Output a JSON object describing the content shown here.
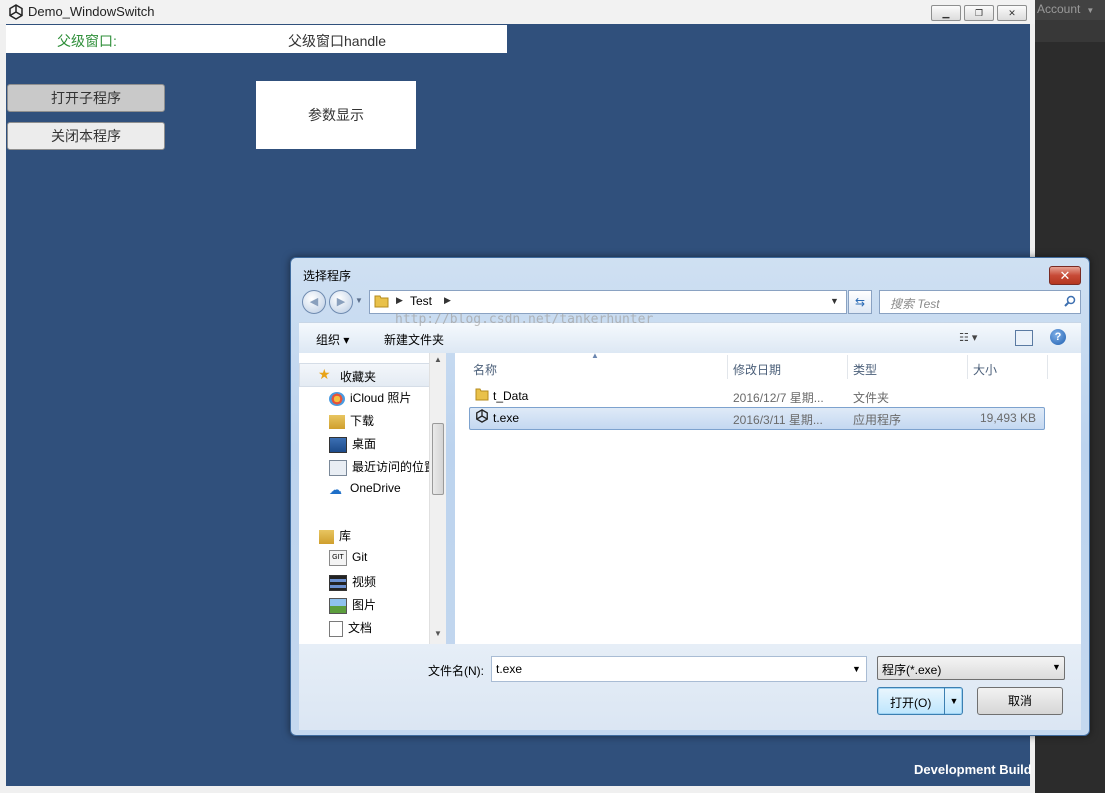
{
  "editor": {
    "account_label": "Account"
  },
  "window": {
    "title": "Demo_WindowSwitch",
    "minimize": "▁",
    "restore": "❐",
    "close": "✕"
  },
  "app": {
    "parent_label": "父级窗口:",
    "parent_handle": "父级窗口handle",
    "open_child_button": "打开子程序",
    "close_self_button": "关闭本程序",
    "param_display": "参数显示",
    "dev_build": "Development Build"
  },
  "dialog": {
    "title": "选择程序",
    "address_path": "Test",
    "search_placeholder": "搜索 Test",
    "toolbar": {
      "organize": "组织 ▾",
      "new_folder": "新建文件夹"
    },
    "nav_pane": {
      "favorites": "收藏夹",
      "favorite_items": [
        "iCloud 照片",
        "下载",
        "桌面",
        "最近访问的位置",
        "OneDrive"
      ],
      "library": "库",
      "library_items": [
        "Git",
        "视频",
        "图片",
        "文档"
      ]
    },
    "columns": {
      "name": "名称",
      "date": "修改日期",
      "type": "类型",
      "size": "大小"
    },
    "files": [
      {
        "name": "t_Data",
        "date": "2016/12/7 星期...",
        "type": "文件夹",
        "size": ""
      },
      {
        "name": "t.exe",
        "date": "2016/3/11 星期...",
        "type": "应用程序",
        "size": "19,493 KB"
      }
    ],
    "watermark": "http://blog.csdn.net/tankerhunter",
    "filename_label": "文件名(N):",
    "filename_value": "t.exe",
    "filetype_value": "程序(*.exe)",
    "open_button": "打开(O)",
    "cancel_button": "取消"
  }
}
